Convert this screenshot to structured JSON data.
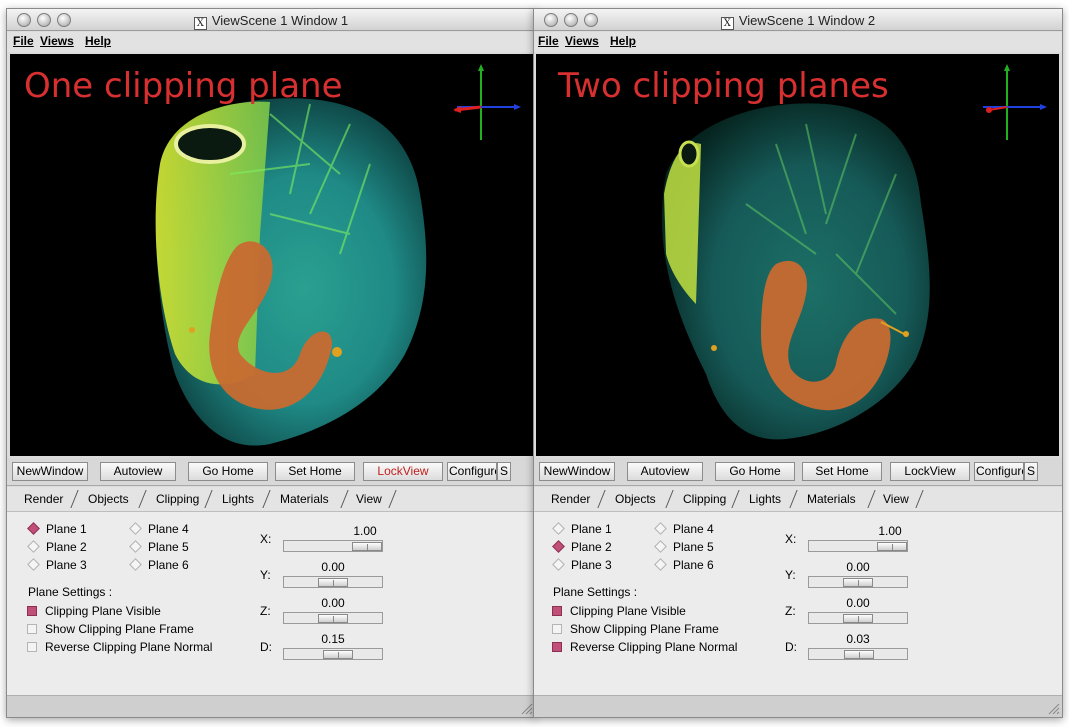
{
  "windows": [
    {
      "title": "ViewScene 1 Window 1",
      "menu": [
        "File",
        "Views",
        "Help"
      ],
      "viewport_label": "One clipping plane",
      "buttons": [
        "NewWindow",
        "Autoview",
        "Go Home",
        "Set Home",
        "LockView",
        "Configure",
        "S"
      ],
      "active_button": "LockView",
      "tabs": [
        "Render",
        "Objects",
        "Clipping",
        "Lights",
        "Materials",
        "View"
      ],
      "planes": [
        "Plane 1",
        "Plane 2",
        "Plane 3",
        "Plane 4",
        "Plane 5",
        "Plane 6"
      ],
      "selected_plane": "Plane 1",
      "plane_settings_label": "Plane Settings :",
      "settings": [
        {
          "label": "Clipping Plane Visible",
          "checked": true
        },
        {
          "label": "Show Clipping Plane Frame",
          "checked": false
        },
        {
          "label": "Reverse Clipping Plane Normal",
          "checked": false
        }
      ],
      "sliders": [
        {
          "label": "X:",
          "value": "1.00",
          "level": 1.0
        },
        {
          "label": "Y:",
          "value": "0.00",
          "level": 0.5
        },
        {
          "label": "Z:",
          "value": "0.00",
          "level": 0.5
        },
        {
          "label": "D:",
          "value": "0.15",
          "level": 0.575
        }
      ]
    },
    {
      "title": "ViewScene 1 Window 2",
      "menu": [
        "File",
        "Views",
        "Help"
      ],
      "viewport_label": "Two clipping planes",
      "buttons": [
        "NewWindow",
        "Autoview",
        "Go Home",
        "Set Home",
        "LockView",
        "Configure",
        "S"
      ],
      "active_button": "",
      "tabs": [
        "Render",
        "Objects",
        "Clipping",
        "Lights",
        "Materials",
        "View"
      ],
      "planes": [
        "Plane 1",
        "Plane 2",
        "Plane 3",
        "Plane 4",
        "Plane 5",
        "Plane 6"
      ],
      "selected_plane": "Plane 2",
      "plane_settings_label": "Plane Settings :",
      "settings": [
        {
          "label": "Clipping Plane Visible",
          "checked": true
        },
        {
          "label": "Show Clipping Plane Frame",
          "checked": false
        },
        {
          "label": "Reverse Clipping Plane Normal",
          "checked": true
        }
      ],
      "sliders": [
        {
          "label": "X:",
          "value": "1.00",
          "level": 1.0
        },
        {
          "label": "Y:",
          "value": "0.00",
          "level": 0.5
        },
        {
          "label": "Z:",
          "value": "0.00",
          "level": 0.5
        },
        {
          "label": "D:",
          "value": "0.03",
          "level": 0.515
        }
      ]
    }
  ],
  "colors": {
    "viewport_label": "#d83030",
    "active_button_text": "#c0201e",
    "checked_indicator": "#c0507a",
    "axis_x": "#e02020",
    "axis_y": "#20b020",
    "axis_z": "#2040e0"
  }
}
